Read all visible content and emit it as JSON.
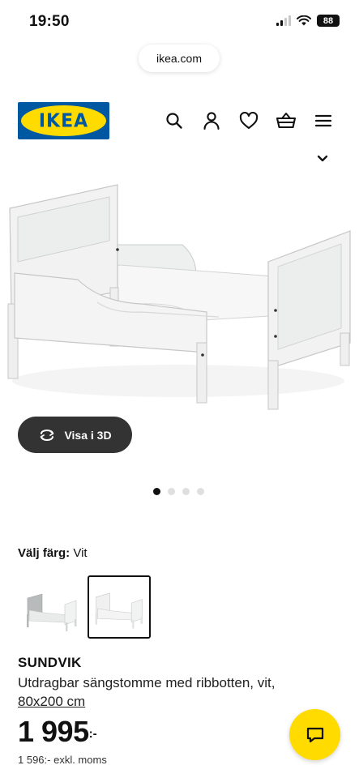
{
  "status_bar": {
    "time": "19:50",
    "battery": "88"
  },
  "browser": {
    "url": "ikea.com"
  },
  "header": {
    "logo_text": "IKEA",
    "icons": [
      "search-icon",
      "account-icon",
      "favorites-icon",
      "basket-icon",
      "menu-icon"
    ]
  },
  "gallery": {
    "view_3d_label": "Visa i 3D",
    "image_count": 4,
    "active_index": 0
  },
  "color": {
    "label": "Välj färg:",
    "value": "Vit"
  },
  "product": {
    "name": "SUNDVIK",
    "description": "Utdragbar sängstomme med ribbotten, vit,",
    "size": "80x200 cm",
    "price": "1 995",
    "price_suffix": ":-",
    "price_excl_vat": "1 596:- exkl. moms"
  },
  "colors": {
    "ikea_blue": "#0058a3",
    "ikea_yellow": "#ffdb00",
    "button_dark": "#333333"
  }
}
